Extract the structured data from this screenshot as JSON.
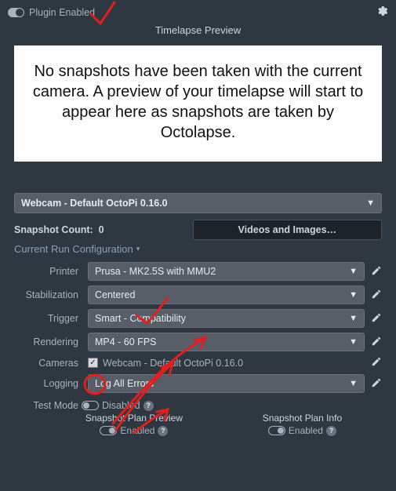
{
  "header": {
    "plugin_toggle_label": "Plugin Enabled"
  },
  "preview": {
    "title": "Timelapse Preview",
    "no_snapshots_msg": "No snapshots have been taken with the current camera. A preview of your timelapse will start to appear here as snapshots are taken by Octolapse."
  },
  "camera_select": {
    "selected": "Webcam - Default OctoPi 0.16.0"
  },
  "snapshot": {
    "count_label": "Snapshot Count:",
    "count_value": "0",
    "videos_btn": "Videos and Images…"
  },
  "config_header": "Current Run Configuration",
  "rows": {
    "printer_label": "Printer",
    "printer_value": "Prusa - MK2.5S with MMU2",
    "stabilization_label": "Stabilization",
    "stabilization_value": "Centered",
    "trigger_label": "Trigger",
    "trigger_value": "Smart - Compatibility",
    "rendering_label": "Rendering",
    "rendering_value": "MP4 - 60 FPS",
    "cameras_label": "Cameras",
    "cameras_value": "Webcam - Default OctoPi 0.16.0",
    "logging_label": "Logging",
    "logging_value": "Log All Errors"
  },
  "testmode": {
    "label": "Test Mode",
    "state": "Disabled"
  },
  "plans": {
    "preview_title": "Snapshot Plan Preview",
    "preview_state": "Enabled",
    "info_title": "Snapshot Plan Info",
    "info_state": "Enabled"
  },
  "icons": {
    "check": "✓",
    "question": "?"
  }
}
